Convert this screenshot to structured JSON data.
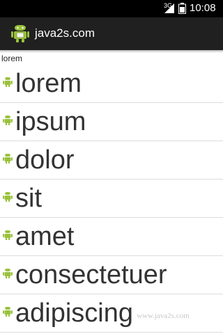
{
  "status_bar": {
    "network": "3G",
    "time": "10:08"
  },
  "action_bar": {
    "icon": "android-robot-icon",
    "title": "java2s.com"
  },
  "selected_text": "lorem",
  "list": {
    "items": [
      {
        "label": "lorem",
        "icon": "android-icon"
      },
      {
        "label": "ipsum",
        "icon": "android-icon"
      },
      {
        "label": "dolor",
        "icon": "android-icon"
      },
      {
        "label": "sit",
        "icon": "android-icon"
      },
      {
        "label": "amet",
        "icon": "android-icon"
      },
      {
        "label": "consectetuer",
        "icon": "android-icon"
      },
      {
        "label": "adipiscing",
        "icon": "android-icon"
      }
    ]
  },
  "watermark": "www.java2s.com",
  "colors": {
    "status_bar": "#000000",
    "action_bar": "#202020",
    "android_green": "#9ac23c",
    "list_text": "#333333",
    "divider": "#dcdcdc"
  }
}
